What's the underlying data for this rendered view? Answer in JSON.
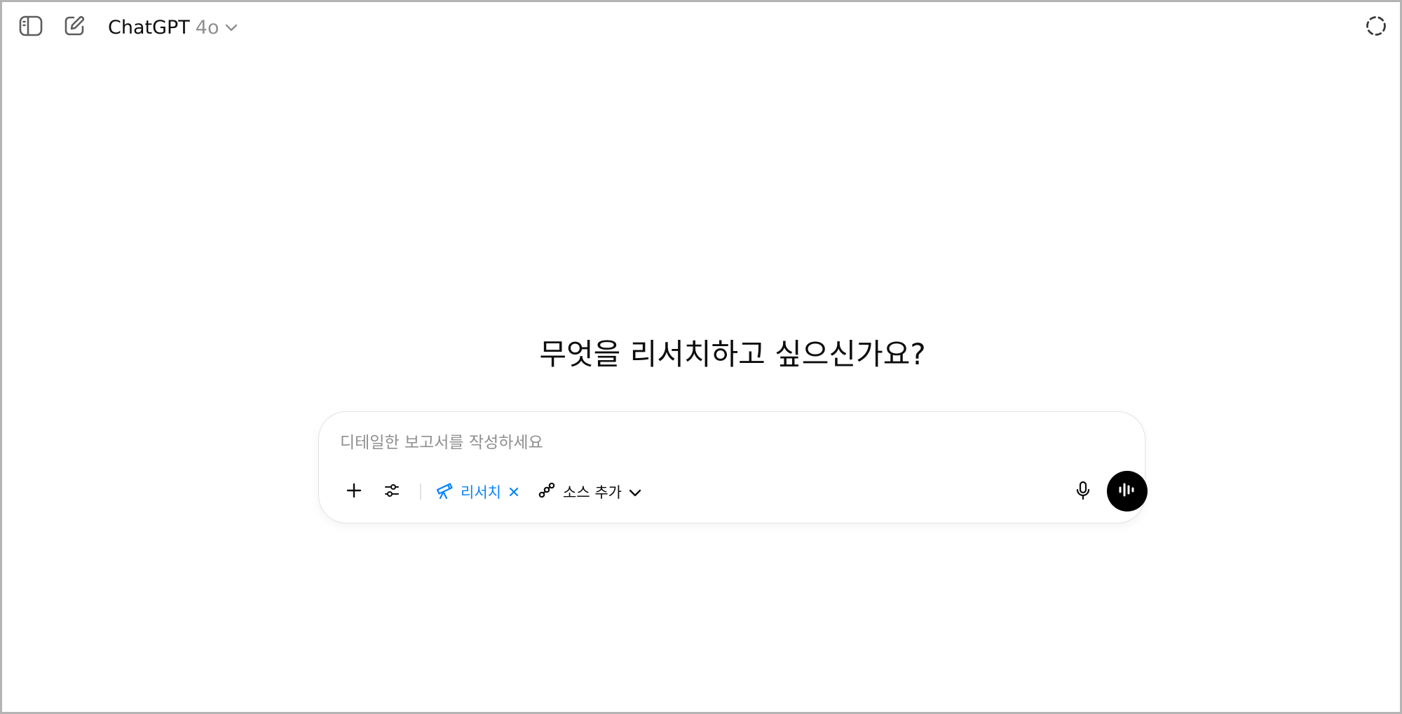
{
  "header": {
    "model_name": "ChatGPT",
    "model_version": "4o"
  },
  "main": {
    "headline": "무엇을 리서치하고 싶으신가요?"
  },
  "composer": {
    "placeholder": "디테일한 보고서를 작성하세요",
    "research_chip_label": "리서치",
    "sources_label": "소스 추가"
  },
  "icons": {
    "sidebar_toggle": "sidebar-icon",
    "new_chat": "edit-icon",
    "model_dropdown": "chevron-down-icon",
    "temporary_chat": "dashed-circle-icon",
    "attach": "plus-icon",
    "tools": "sliders-icon",
    "research": "telescope-icon",
    "research_remove": "close-icon",
    "sources": "link-icon",
    "sources_dropdown": "chevron-down-icon",
    "dictation": "microphone-icon",
    "voice_mode": "waveform-icon"
  },
  "colors": {
    "accent": "#0a84ff",
    "text": "#0d0d0d",
    "muted": "#8f8f8f",
    "border": "#e3e3e3"
  }
}
